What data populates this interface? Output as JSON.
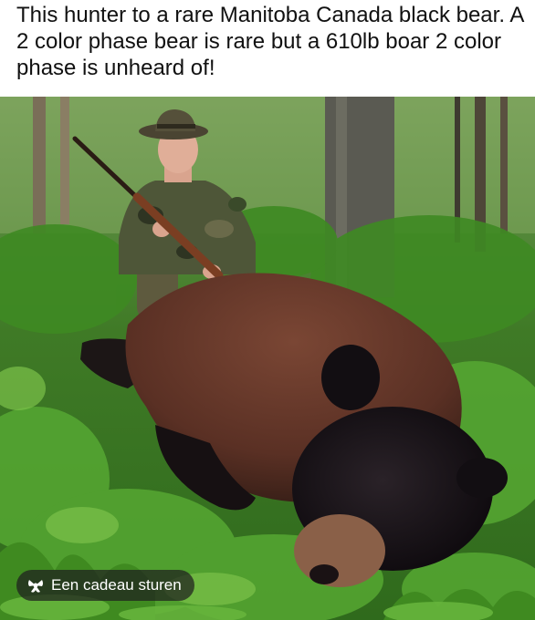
{
  "post": {
    "caption": "This hunter to a rare Manitoba Canada black bear. A 2 color phase bear is rare but a 610lb boar 2 color phase is unheard of!",
    "photo_alt": "Hunter in camouflage kneeling with a rifle behind a large two-color black bear lying in green forest undergrowth",
    "gift_button_label": "Een cadeau sturen",
    "gift_icon": "gift-bow-icon"
  },
  "colors": {
    "caption_text": "#111111",
    "gift_button_bg": "#1e1e1e",
    "gift_button_text": "#ffffff",
    "foliage": "#4a8a2a",
    "bear_brown": "#6b3b2a",
    "bear_black": "#1a1418"
  }
}
